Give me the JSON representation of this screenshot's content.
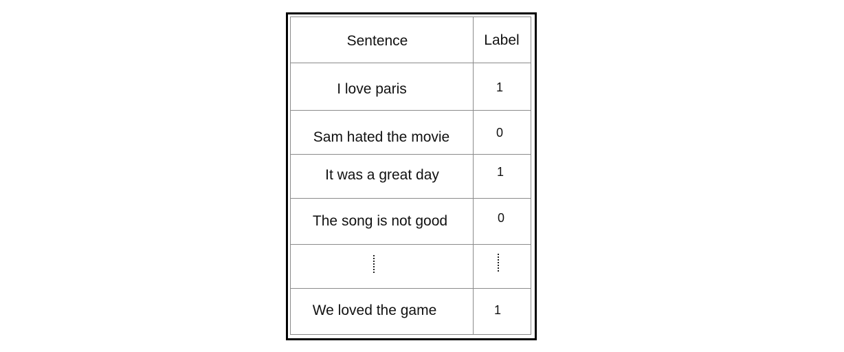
{
  "table": {
    "headers": {
      "sentence": "Sentence",
      "label": "Label"
    },
    "rows": [
      {
        "sentence": "I love paris",
        "label": "1"
      },
      {
        "sentence": "Sam hated the movie",
        "label": "0"
      },
      {
        "sentence": "It was a great day",
        "label": "1"
      },
      {
        "sentence": "The song is not good",
        "label": "0"
      },
      {
        "sentence": "We loved the game",
        "label": "1"
      }
    ],
    "ellipsis_row": "vertical-ellipsis"
  }
}
